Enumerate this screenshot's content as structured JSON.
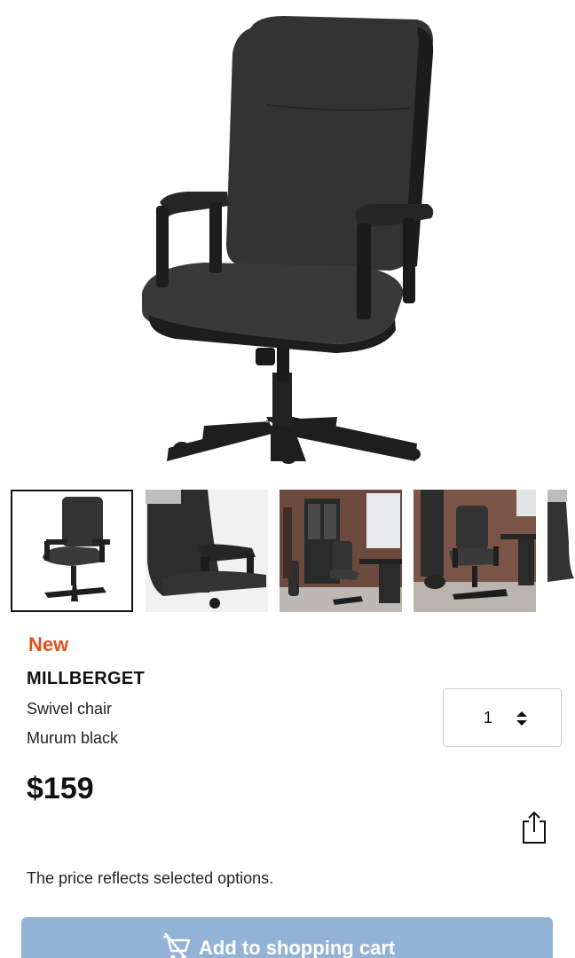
{
  "product": {
    "badge": "New",
    "name": "MILLBERGET",
    "type": "Swivel chair",
    "color_name": "Murum black",
    "price": "$159",
    "price_note": "The price reflects selected options."
  },
  "quantity": {
    "value": "1"
  },
  "cart_button": {
    "label": "Add to shopping cart"
  },
  "gallery": {
    "selected_index": 0,
    "thumbnail_count": 5
  },
  "colors": {
    "badge_new": "#d9531e",
    "cart_button_bg": "#93b3d6",
    "chair": "#2f2f2f"
  }
}
